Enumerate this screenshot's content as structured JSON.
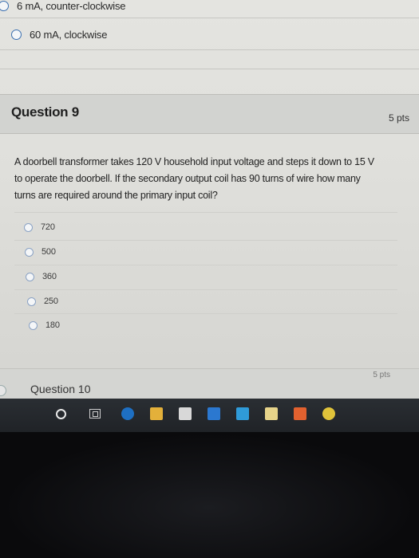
{
  "previous_question": {
    "options": [
      {
        "label": "6 mA, counter-clockwise"
      },
      {
        "label": "60 mA, clockwise"
      }
    ]
  },
  "question9": {
    "title": "Question 9",
    "points": "5 pts",
    "text_lines": [
      "A doorbell transformer takes 120 V household input voltage and steps it down to 15 V",
      "to operate the doorbell. If the secondary output coil has 90 turns of wire how many",
      "turns are required around the primary input coil?"
    ],
    "options": [
      "720",
      "500",
      "360",
      "250",
      "180"
    ]
  },
  "question10": {
    "title": "Question 10",
    "points": "5 pts"
  },
  "taskbar": {
    "icons": [
      "search-icon",
      "task-view-icon",
      "edge-icon",
      "file-explorer-icon",
      "store-icon",
      "mail-icon",
      "app-l-icon",
      "app-photo-icon",
      "app-orange-icon",
      "chrome-icon"
    ]
  },
  "colors": {
    "radio_border": "#3a6fb0",
    "page_bg": "#e2e2de",
    "header_bg": "#d2d3d0",
    "taskbar_bg": "#24272b"
  }
}
